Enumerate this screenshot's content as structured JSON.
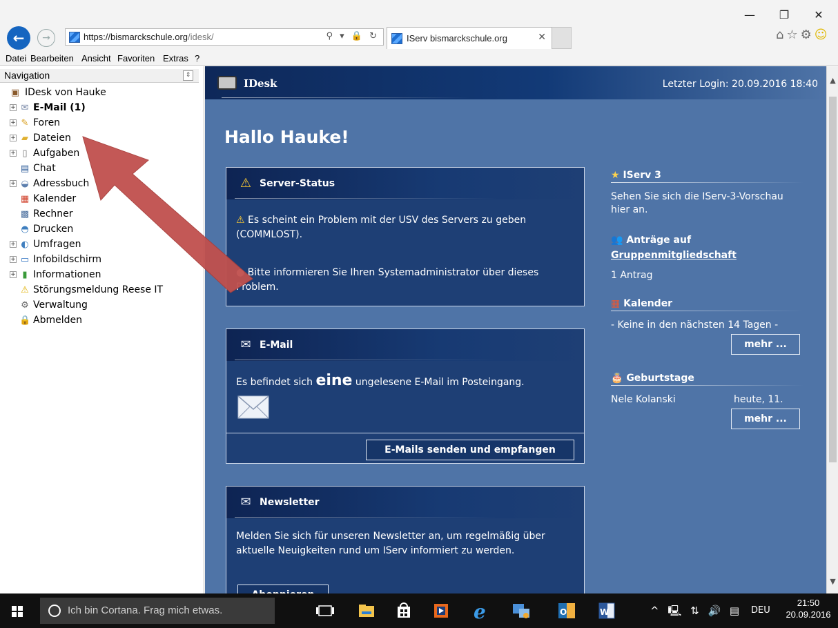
{
  "browser": {
    "window_controls": {
      "minimize": "—",
      "maximize": "❐",
      "close": "✕"
    },
    "address": {
      "host": "https://bismarckschule.org",
      "path": "/idesk/"
    },
    "address_tools": "⚲ ▾ 🔒 ↻",
    "tab_title": "IServ bismarckschule.org",
    "tab_close": "✕",
    "menu": [
      "Datei",
      "Bearbeiten",
      "Ansicht",
      "Favoriten",
      "Extras",
      "?"
    ],
    "right_icons": {
      "home": "⌂",
      "star": "☆",
      "settings": "⚙",
      "smiley": "☺"
    }
  },
  "nav": {
    "title": "Navigation",
    "items": [
      {
        "label": "IDesk von Hauke",
        "icon": "idesk-icon",
        "expander": false,
        "bold": false
      },
      {
        "label": "E-Mail (1)",
        "icon": "mail-icon",
        "expander": true,
        "bold": true
      },
      {
        "label": "Foren",
        "icon": "forum-icon",
        "expander": true,
        "bold": false
      },
      {
        "label": "Dateien",
        "icon": "folder-icon",
        "expander": true,
        "bold": false
      },
      {
        "label": "Aufgaben",
        "icon": "clipboard-icon",
        "expander": true,
        "bold": false
      },
      {
        "label": "Chat",
        "icon": "chat-icon",
        "expander": false,
        "bold": false
      },
      {
        "label": "Adressbuch",
        "icon": "addressbook-icon",
        "expander": true,
        "bold": false
      },
      {
        "label": "Kalender",
        "icon": "calendar-icon",
        "expander": false,
        "bold": false
      },
      {
        "label": "Rechner",
        "icon": "computer-icon",
        "expander": false,
        "bold": false
      },
      {
        "label": "Drucken",
        "icon": "printer-icon",
        "expander": false,
        "bold": false
      },
      {
        "label": "Umfragen",
        "icon": "poll-icon",
        "expander": true,
        "bold": false
      },
      {
        "label": "Infobildschirm",
        "icon": "monitor-icon",
        "expander": true,
        "bold": false
      },
      {
        "label": "Informationen",
        "icon": "info-icon",
        "expander": true,
        "bold": false
      },
      {
        "label": "Störungsmeldung Reese IT",
        "icon": "warning-icon",
        "expander": false,
        "bold": false
      },
      {
        "label": "Verwaltung",
        "icon": "gear-icon",
        "expander": false,
        "bold": false
      },
      {
        "label": "Abmelden",
        "icon": "lock-icon",
        "expander": false,
        "bold": false
      }
    ]
  },
  "idesk": {
    "title": "IDesk",
    "last_login": "Letzter Login: 20.09.2016 18:40",
    "greeting": "Hallo Hauke!"
  },
  "server_status": {
    "title": "Server-Status",
    "line1": "Es scheint ein Problem mit der USV des Servers zu geben (COMMLOST).",
    "line2": "Bitte informieren Sie Ihren Systemadministrator über dieses Problem."
  },
  "email": {
    "title": "E-Mail",
    "text_before": "Es befindet sich ",
    "count_word": "eine",
    "text_after": " ungelesene E-Mail im Posteingang.",
    "button": "E-Mails senden und empfangen"
  },
  "newsletter": {
    "title": "Newsletter",
    "text": "Melden Sie sich für unseren Newsletter an, um regelmäßig über aktuelle Neuigkeiten rund um IServ informiert zu werden.",
    "button": "Abonnieren"
  },
  "sidebar": {
    "iserv3": {
      "title": "IServ 3",
      "text": "Sehen Sie sich die IServ-3-Vorschau hier an."
    },
    "antraege": {
      "title_line1": "Anträge auf",
      "title_line2": "Gruppenmitgliedschaft",
      "text": "1 Antrag"
    },
    "kalender": {
      "title": "Kalender",
      "text": "- Keine in den nächsten 14 Tagen -",
      "button": "mehr ..."
    },
    "geburtstage": {
      "title": "Geburtstage",
      "name": "Nele Kolanski",
      "when": "heute, 11.",
      "button": "mehr ..."
    }
  },
  "taskbar": {
    "cortana": "Ich bin Cortana. Frag mich etwas.",
    "tray_text": "^ 🖳 ⇅ 🔊 ▤",
    "language": "DEU",
    "time": "21:50",
    "date": "20.09.2016"
  },
  "colors": {
    "main_bg": "#4f74a7",
    "card_bg": "#1e3f75",
    "arrow": "#c0504d",
    "taskbar": "#101010"
  }
}
